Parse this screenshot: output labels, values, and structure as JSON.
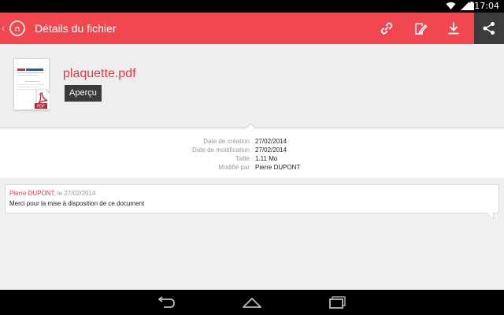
{
  "status_bar": {
    "time": "17:04",
    "icons": [
      "wifi-icon",
      "signal-icon",
      "battery-icon"
    ]
  },
  "app_bar": {
    "title": "Détails du fichier",
    "logo_letter": "n",
    "actions": [
      "link-icon",
      "edit-icon",
      "download-icon",
      "share-icon"
    ],
    "color": "#f0484e"
  },
  "file": {
    "name": "plaquette.pdf",
    "preview_label": "Aperçu",
    "thumb_badge": "PDF"
  },
  "metadata": {
    "labels": [
      "Date de création",
      "Date de modification",
      "Taille",
      "Modifié par"
    ],
    "values": [
      "27/02/2014",
      "27/02/2014",
      "1.11 Mo",
      "Pierre DUPONT"
    ]
  },
  "comment": {
    "author": "Pierre DUPONT",
    "date": ", le 27/02/2014",
    "text": "Merci pour la mise à disposition de ce document"
  },
  "nav_bar": {
    "buttons": [
      "back-icon",
      "home-icon",
      "recents-icon"
    ]
  },
  "colors": {
    "accent": "#f0484e",
    "accent_text": "#e6393f",
    "header_bg": "#eeeeee"
  }
}
